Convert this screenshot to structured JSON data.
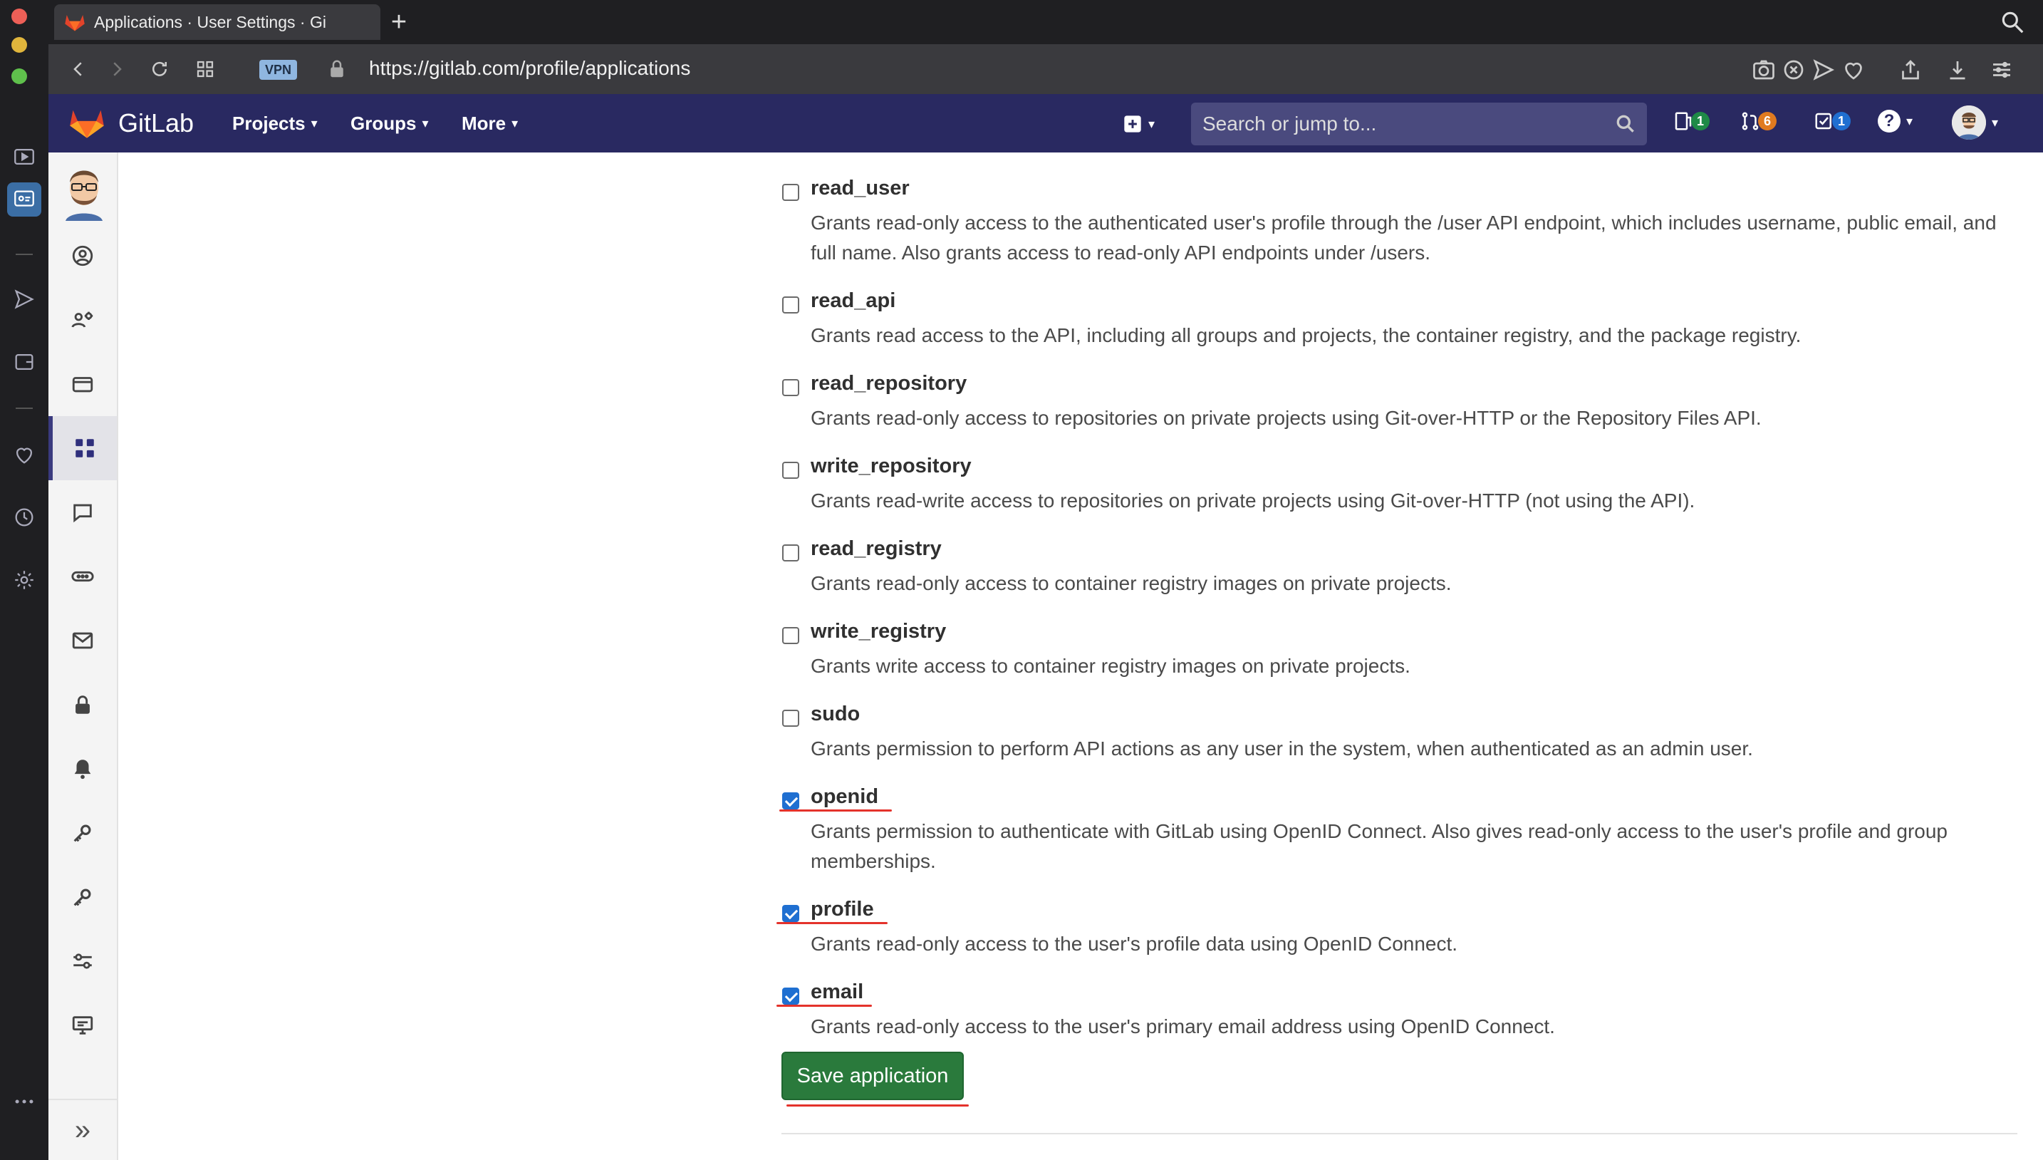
{
  "browser": {
    "tab_title": "Applications · User Settings · Gi",
    "url": "https://gitlab.com/profile/applications",
    "vpn_label": "VPN"
  },
  "header": {
    "brand": "GitLab",
    "menus": [
      {
        "label": "Projects"
      },
      {
        "label": "Groups"
      },
      {
        "label": "More"
      }
    ],
    "search_placeholder": "Search or jump to...",
    "issues_count": "1",
    "merge_requests_count": "6",
    "todos_count": "1",
    "help_glyph": "?"
  },
  "sidebar": {
    "active_item": "applications",
    "collapse_glyph": "»"
  },
  "scopes": [
    {
      "name": "read_user",
      "checked": false,
      "description": "Grants read-only access to the authenticated user's profile through the /user API endpoint, which includes username, public email, and full name. Also grants access to read-only API endpoints under /users."
    },
    {
      "name": "read_api",
      "checked": false,
      "description": "Grants read access to the API, including all groups and projects, the container registry, and the package registry."
    },
    {
      "name": "read_repository",
      "checked": false,
      "description": "Grants read-only access to repositories on private projects using Git-over-HTTP or the Repository Files API."
    },
    {
      "name": "write_repository",
      "checked": false,
      "description": "Grants read-write access to repositories on private projects using Git-over-HTTP (not using the API)."
    },
    {
      "name": "read_registry",
      "checked": false,
      "description": "Grants read-only access to container registry images on private projects."
    },
    {
      "name": "write_registry",
      "checked": false,
      "description": "Grants write access to container registry images on private projects."
    },
    {
      "name": "sudo",
      "checked": false,
      "description": "Grants permission to perform API actions as any user in the system, when authenticated as an admin user."
    },
    {
      "name": "openid",
      "checked": true,
      "description": "Grants permission to authenticate with GitLab using OpenID Connect. Also gives read-only access to the user's profile and group memberships."
    },
    {
      "name": "profile",
      "checked": true,
      "description": "Grants read-only access to the user's profile data using OpenID Connect."
    },
    {
      "name": "email",
      "checked": true,
      "description": "Grants read-only access to the user's primary email address using OpenID Connect."
    }
  ],
  "save_label": "Save application",
  "colors": {
    "header_bg": "#292961",
    "save_button": "#2a7a3c",
    "annotation_red": "#e4322b",
    "checkbox_blue": "#1f6fd1"
  }
}
